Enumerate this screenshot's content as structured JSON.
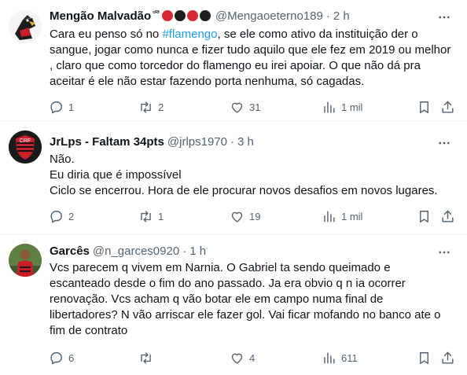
{
  "tweets": [
    {
      "display_name": "Mengão Malvadão",
      "badge": "ᶜᴿᶠ",
      "badge_circles": [
        "#d62b34",
        "#1f1f1f",
        "#d62b34",
        "#1f1f1f"
      ],
      "handle": "@Mengaoeterno189",
      "time": "2 h",
      "text_pre": "Cara eu penso só no ",
      "hashtag": "#flamengo",
      "text_post": ", se ele como ativo da instituição der o sangue, jogar como nunca e fizer tudo aquilo que ele fez em 2019 ou melhor , claro que como torcedor do flamengo eu irei apoiar. O que não dá pra aceitar é ele não estar fazendo porta nenhuma, só cagadas.",
      "replies": "1",
      "retweets": "2",
      "likes": "31",
      "views": "1 mil"
    },
    {
      "display_name": "JrLps - Faltam 34pts",
      "handle": "@jrlps1970",
      "time": "3 h",
      "lines": [
        "Não.",
        "Eu diria que é impossível",
        "Ciclo se encerrou. Hora de ele procurar novos desafios em novos lugares."
      ],
      "replies": "2",
      "retweets": "1",
      "likes": "19",
      "views": "1 mil"
    },
    {
      "display_name": "Garcês",
      "handle": "@n_garces0920",
      "time": "1 h",
      "text": "Vcs parecem q vivem em Narnia. O Gabriel ta sendo queimado e escanteado desde o fim do ano passado. Ja era obvio q n ia ocorrer renovação. Vcs acham q vão botar ele em campo numa final de libertadores? N vão arriscar ele fazer gol. Vai ficar mofando no banco ate o fim de contrato",
      "replies": "6",
      "retweets": "",
      "likes": "4",
      "views": "611"
    }
  ],
  "colors": {
    "text": "#0f1419",
    "secondary": "#536471",
    "link": "#1d9bf0",
    "divider": "#eff3f4"
  }
}
